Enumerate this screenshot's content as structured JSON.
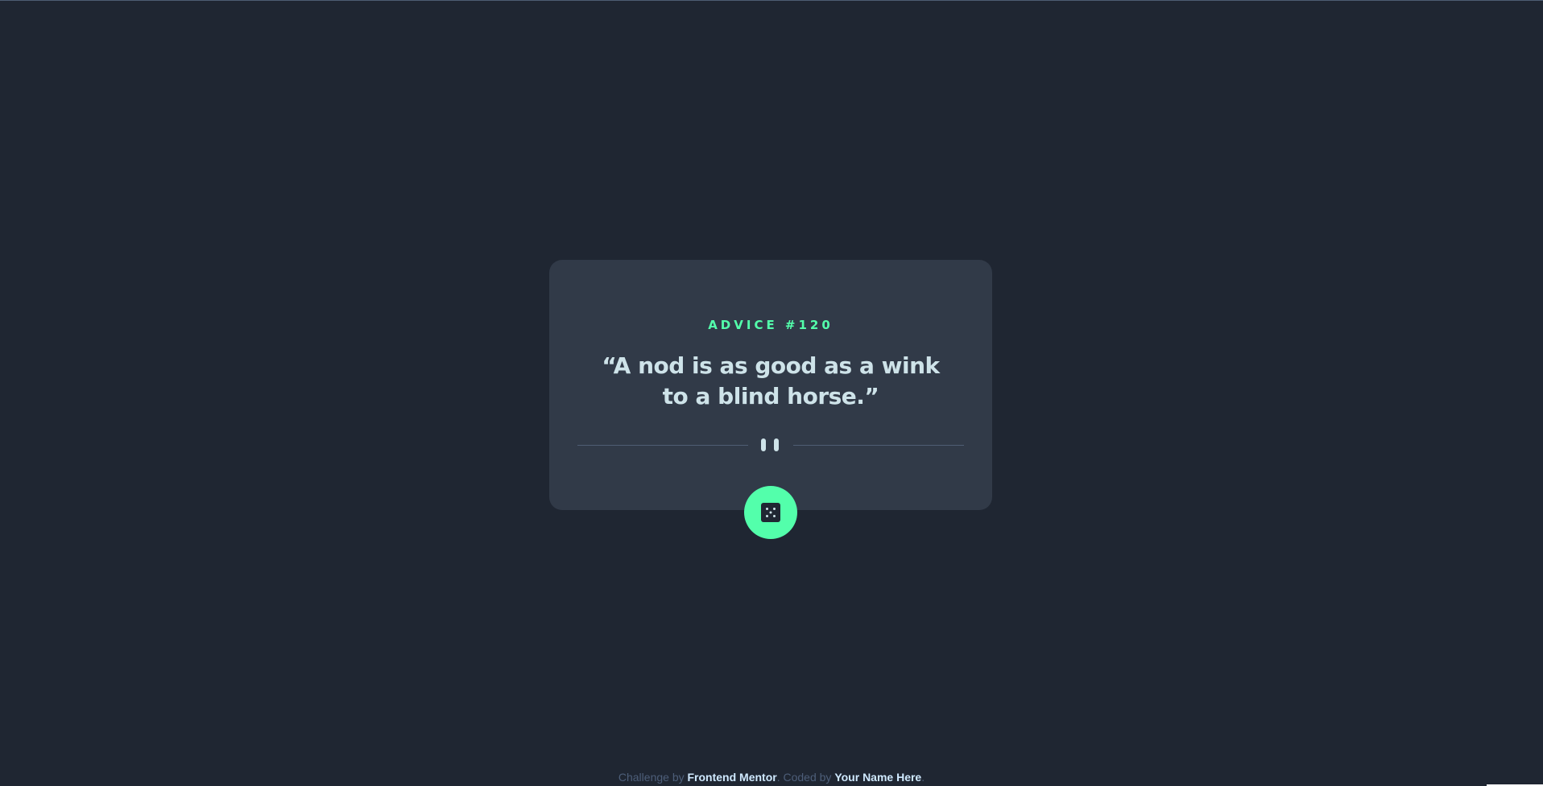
{
  "card": {
    "title": "ADVICE #120",
    "advice": "“A nod is as good as a wink to a blind horse.”"
  },
  "divider": {
    "icon": "pause-icon"
  },
  "button": {
    "icon": "dice-icon"
  },
  "footer": {
    "challenge_prefix": "Challenge by ",
    "challenge_link": "Frontend Mentor",
    "coded_prefix": ". Coded by ",
    "coded_link": "Your Name Here",
    "suffix": "."
  },
  "colors": {
    "background": "#1f2632",
    "card": "#313a48",
    "accent": "#53ffab",
    "text": "#cee3e9",
    "muted": "#4d5e79"
  }
}
